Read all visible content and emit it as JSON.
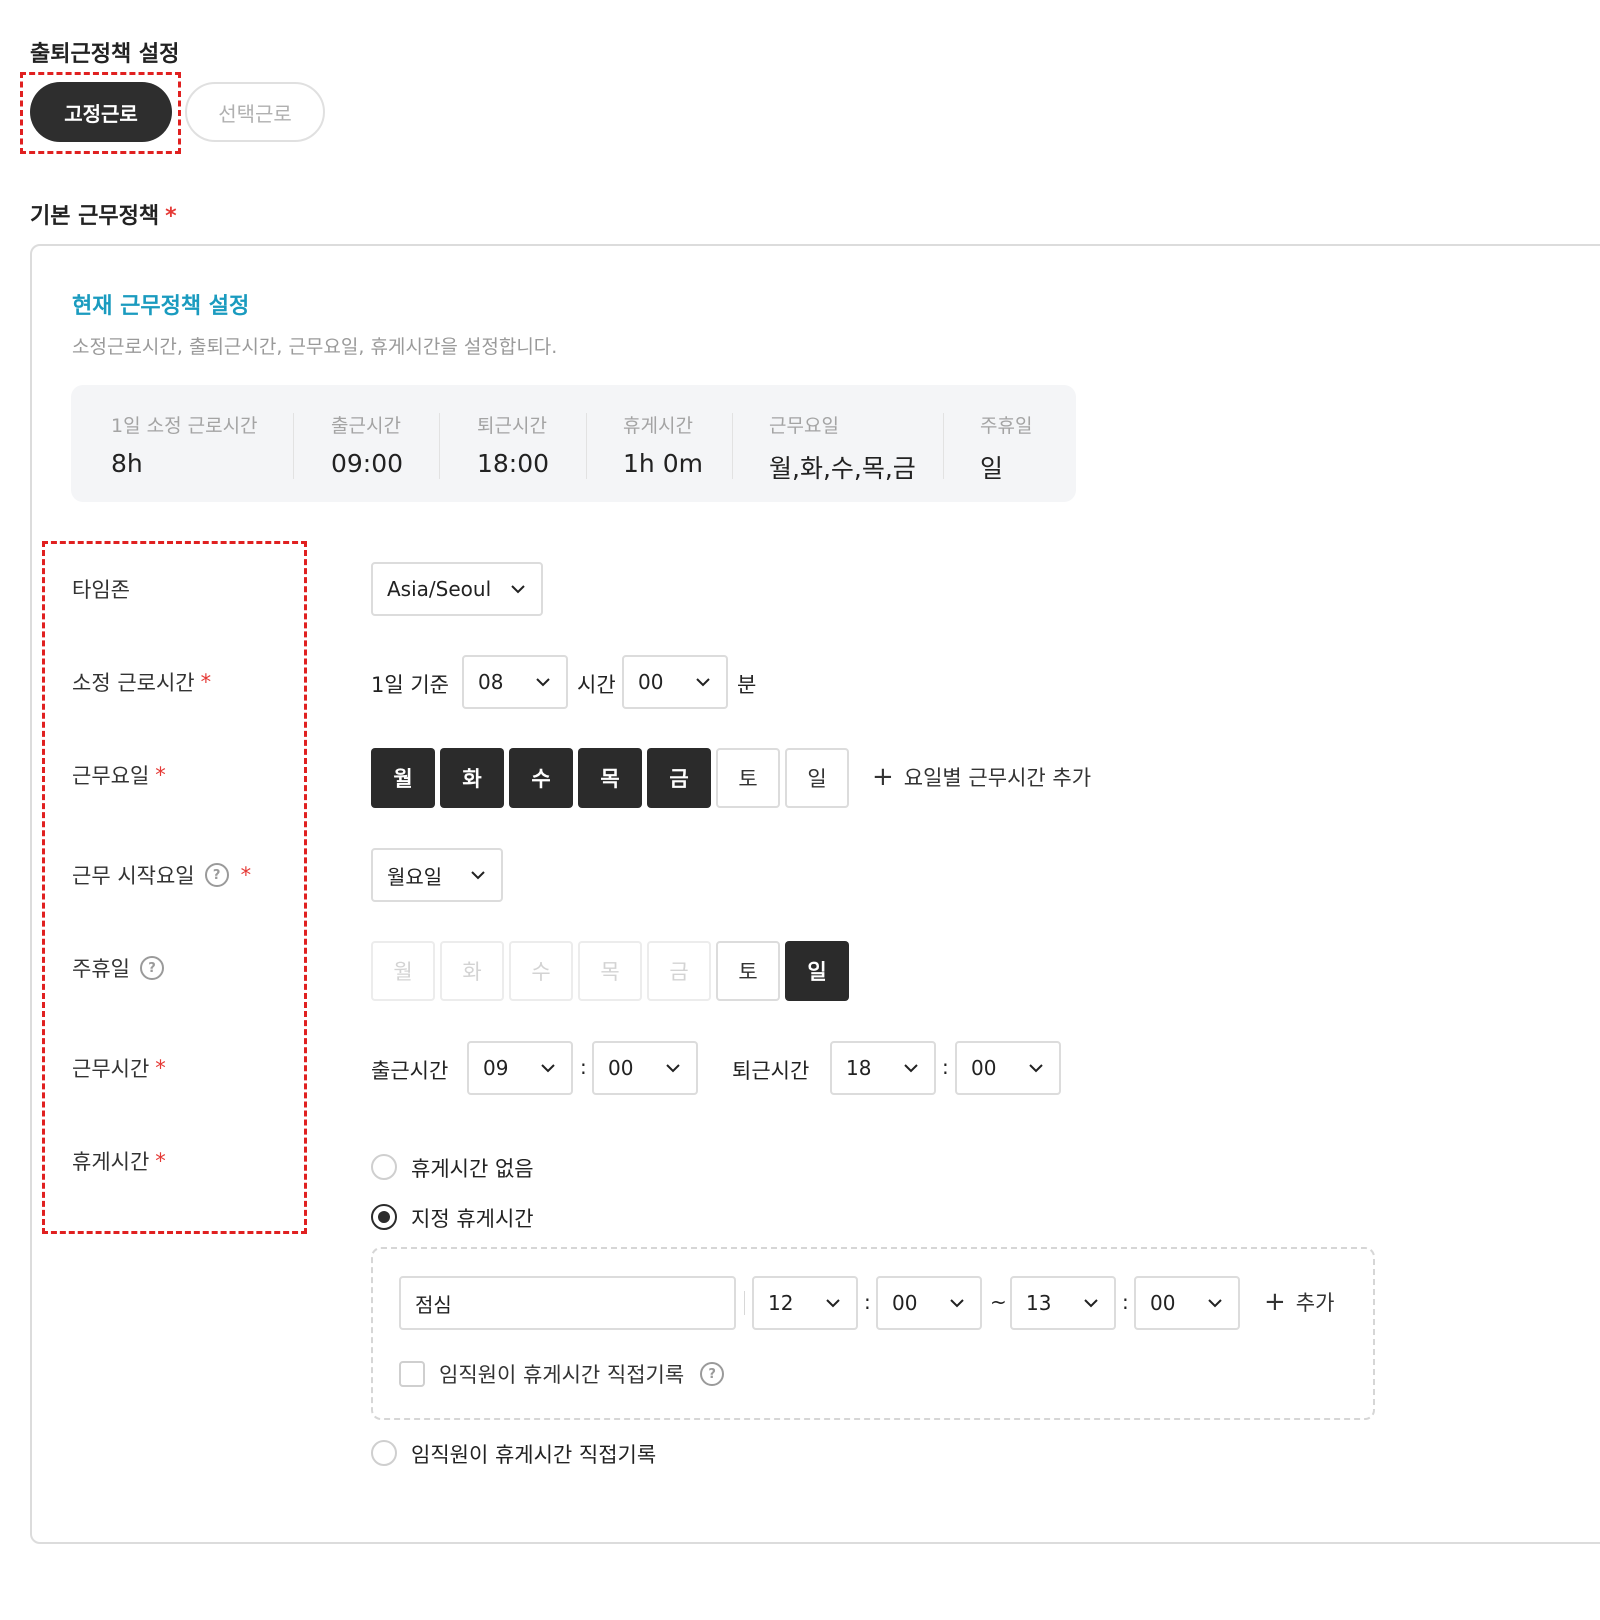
{
  "policy_setting": {
    "title": "출퇴근정책 설정",
    "types": [
      {
        "label": "고정근로",
        "selected": true
      },
      {
        "label": "선택근로",
        "selected": false
      }
    ]
  },
  "basic_policy": {
    "title": "기본 근무정책",
    "required_mark": "*"
  },
  "current_policy": {
    "title": "현재 근무정책 설정",
    "subtitle": "소정근로시간, 출퇴근시간, 근무요일, 휴게시간을 설정합니다."
  },
  "summary": {
    "items": [
      {
        "label": "1일 소정 근로시간",
        "value": "8h"
      },
      {
        "label": "출근시간",
        "value": "09:00"
      },
      {
        "label": "퇴근시간",
        "value": "18:00"
      },
      {
        "label": "휴게시간",
        "value": "1h 0m"
      },
      {
        "label": "근무요일",
        "value": "월,화,수,목,금"
      },
      {
        "label": "주휴일",
        "value": "일"
      }
    ]
  },
  "rows": {
    "timezone": {
      "label": "타임존",
      "value": "Asia/Seoul"
    },
    "work_hours": {
      "label": "소정 근로시간",
      "prefix": "1일 기준",
      "hour": "08",
      "hour_unit": "시간",
      "minute": "00",
      "minute_unit": "분"
    },
    "work_days": {
      "label": "근무요일",
      "days": [
        {
          "label": "월",
          "on": true
        },
        {
          "label": "화",
          "on": true
        },
        {
          "label": "수",
          "on": true
        },
        {
          "label": "목",
          "on": true
        },
        {
          "label": "금",
          "on": true
        },
        {
          "label": "토",
          "on": false
        },
        {
          "label": "일",
          "on": false
        }
      ],
      "add_label": "요일별 근무시간 추가"
    },
    "start_day": {
      "label": "근무 시작요일",
      "value": "월요일"
    },
    "weekly_holiday": {
      "label": "주휴일",
      "days": [
        {
          "label": "월",
          "state": "disabled"
        },
        {
          "label": "화",
          "state": "disabled"
        },
        {
          "label": "수",
          "state": "disabled"
        },
        {
          "label": "목",
          "state": "disabled"
        },
        {
          "label": "금",
          "state": "disabled"
        },
        {
          "label": "토",
          "state": "off"
        },
        {
          "label": "일",
          "state": "on"
        }
      ]
    },
    "work_time": {
      "label": "근무시간",
      "start_label": "출근시간",
      "start_hour": "09",
      "start_minute": "00",
      "end_label": "퇴근시간",
      "end_hour": "18",
      "end_minute": "00",
      "colon": ":"
    },
    "break_time": {
      "label": "휴게시간",
      "options": [
        {
          "label": "휴게시간 없음",
          "selected": false
        },
        {
          "label": "지정 휴게시간",
          "selected": true
        },
        {
          "label": "임직원이 휴게시간 직접기록",
          "selected": false
        }
      ],
      "entry": {
        "name": "점심",
        "start_hour": "12",
        "start_minute": "00",
        "tilde": "~",
        "end_hour": "13",
        "end_minute": "00",
        "add_label": "추가"
      },
      "self_record_label": "임직원이 휴게시간 직접기록",
      "self_record_checked": false
    }
  },
  "icons": {
    "help": "?",
    "plus": "+",
    "chevron": "chevron-down-icon"
  },
  "colors": {
    "accent": "#1a9bbf",
    "required": "#e53935",
    "dark": "#2b2b2b",
    "highlight": "#e02020"
  }
}
